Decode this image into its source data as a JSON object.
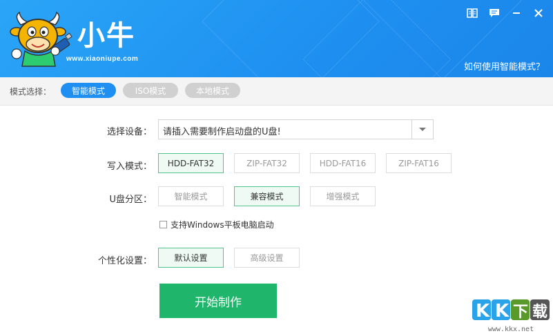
{
  "header": {
    "brand_name": "小牛",
    "brand_url": "www.xiaoniupe.com",
    "help_link": "如何使用智能模式？",
    "window_controls": [
      "book-icon",
      "feedback-icon",
      "minimize-icon",
      "close-icon"
    ],
    "colors": {
      "accent": "#1f8ff1",
      "header_bg": "#2196f3"
    }
  },
  "mode_bar": {
    "label": "模式选择：",
    "tabs": [
      {
        "label": "智能模式",
        "active": true
      },
      {
        "label": "ISO模式",
        "active": false
      },
      {
        "label": "本地模式",
        "active": false
      }
    ]
  },
  "form": {
    "device": {
      "label": "选择设备：",
      "value": "请插入需要制作启动盘的U盘!"
    },
    "write_mode": {
      "label": "写入模式：",
      "options": [
        {
          "label": "HDD-FAT32",
          "selected": true
        },
        {
          "label": "ZIP-FAT32",
          "selected": false
        },
        {
          "label": "HDD-FAT16",
          "selected": false
        },
        {
          "label": "ZIP-FAT16",
          "selected": false
        }
      ]
    },
    "partition": {
      "label": "U盘分区：",
      "options": [
        {
          "label": "智能模式",
          "selected": false
        },
        {
          "label": "兼容模式",
          "selected": true
        },
        {
          "label": "增强模式",
          "selected": false
        }
      ]
    },
    "tablet_checkbox": {
      "label": "支持Windows平板电脑启动",
      "checked": false
    },
    "personalize": {
      "label": "个性化设置：",
      "options": [
        {
          "label": "默认设置",
          "selected": true
        },
        {
          "label": "高级设置",
          "selected": false
        }
      ]
    },
    "start_button": "开始制作",
    "start_color": "#1fb56b"
  },
  "watermark": {
    "text": "KK下载",
    "url": "www.kkx.net"
  }
}
